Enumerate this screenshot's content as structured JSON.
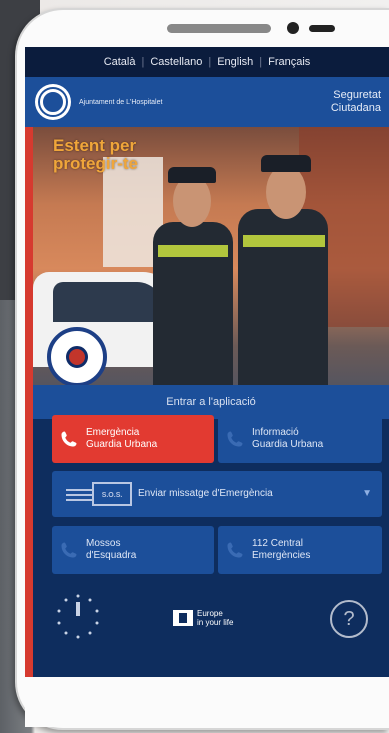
{
  "languages": [
    "Català",
    "Castellano",
    "English",
    "Français"
  ],
  "header": {
    "organization": "Ajuntament de L'Hospitalet",
    "brand_line1": "Seguretat",
    "brand_line2": "Ciutadana"
  },
  "hero": {
    "slogan_line1": "Estent per",
    "slogan_line2": "protegir-te",
    "enter_label": "Entrar a l'aplicació"
  },
  "buttons": {
    "emergency_line1": "Emergència",
    "emergency_line2": "Guardia Urbana",
    "info_line1": "Informació",
    "info_line2": "Guardia Urbana",
    "sos_badge": "S.O.S.",
    "sos_label": "Enviar missatge d'Emergència",
    "mossos_line1": "Mossos",
    "mossos_line2": "d'Esquadra",
    "central_line1": "112 Central",
    "central_line2": "Emergències"
  },
  "footer": {
    "europe_line1": "Europe",
    "europe_line2": "in your life",
    "help_symbol": "?"
  },
  "colors": {
    "red_button": "#e23a31",
    "blue_button": "#1c4f9a",
    "screen_bg": "#0e2d5e"
  }
}
